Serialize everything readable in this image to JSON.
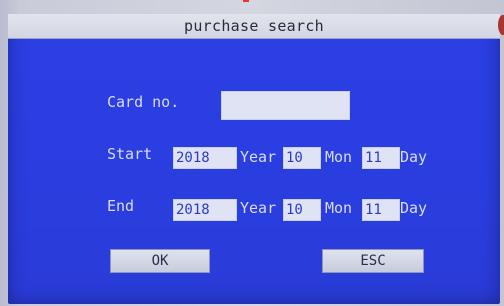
{
  "window": {
    "title": "purchase search"
  },
  "form": {
    "card_label": "Card no.",
    "card_value": "",
    "start_label": "Start",
    "start_year": "2018",
    "start_month": "10",
    "start_day": "11",
    "end_label": "End",
    "end_year": "2018",
    "end_month": "10",
    "end_day": "11",
    "year_label": "Year",
    "mon_label": "Mon",
    "day_label": "Day"
  },
  "buttons": {
    "ok_label": "OK",
    "esc_label": "ESC"
  },
  "colors": {
    "screen": "#2b3fe4",
    "field": "#dfe3f3",
    "label": "#d7dcff",
    "titlebar": "#d3d6e2"
  }
}
